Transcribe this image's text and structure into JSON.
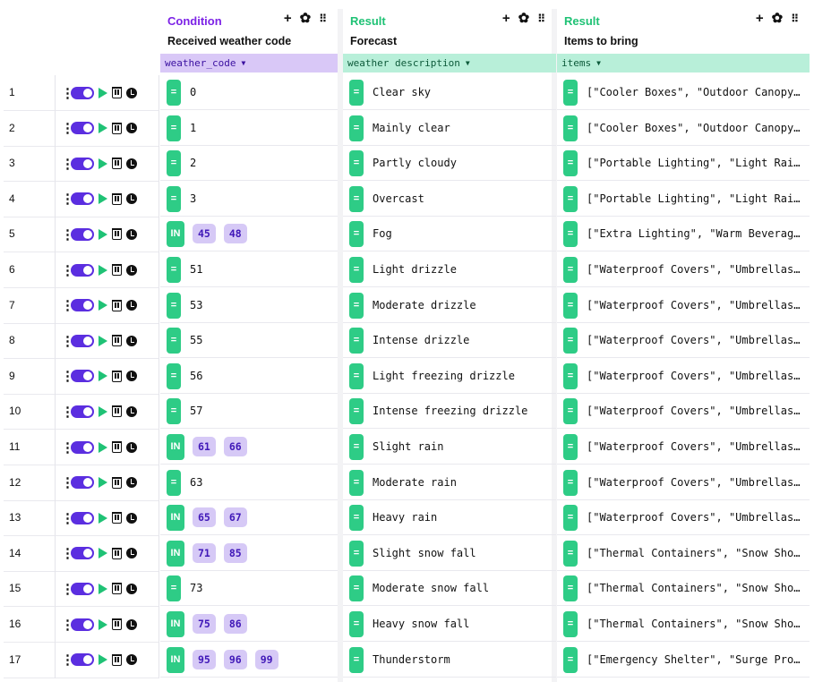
{
  "columns": {
    "condition": {
      "type": "Condition",
      "title": "Received weather code",
      "field": "weather_code"
    },
    "forecast": {
      "type": "Result",
      "title": "Forecast",
      "field": "weather description"
    },
    "items": {
      "type": "Result",
      "title": "Items to bring",
      "field": "items"
    }
  },
  "icons": {
    "add": "plus-icon",
    "settings": "gear-icon",
    "drag": "grip-icon",
    "row_menu": "kebab-icon",
    "toggle": "toggle-icon",
    "run": "play-icon",
    "delete": "trash-icon",
    "history": "clock-icon"
  },
  "colors": {
    "condition_accent": "#7c22e6",
    "result_accent": "#1fc275",
    "toggle": "#5b2ee0",
    "operator": "#2ecc86",
    "chip": "#d6c9f6"
  },
  "rows": [
    {
      "num": "1",
      "op": "=",
      "values": [
        "0"
      ],
      "forecast": "Clear sky",
      "items": "[\"Cooler Boxes\", \"Outdoor Canopy…"
    },
    {
      "num": "2",
      "op": "=",
      "values": [
        "1"
      ],
      "forecast": "Mainly clear",
      "items": "[\"Cooler Boxes\", \"Outdoor Canopy…"
    },
    {
      "num": "3",
      "op": "=",
      "values": [
        "2"
      ],
      "forecast": "Partly cloudy",
      "items": "[\"Portable Lighting\", \"Light Rai…"
    },
    {
      "num": "4",
      "op": "=",
      "values": [
        "3"
      ],
      "forecast": "Overcast",
      "items": "[\"Portable Lighting\", \"Light Rai…"
    },
    {
      "num": "5",
      "op": "IN",
      "values": [
        "45",
        "48"
      ],
      "forecast": "Fog",
      "items": "[\"Extra Lighting\", \"Warm Beverag…"
    },
    {
      "num": "6",
      "op": "=",
      "values": [
        "51"
      ],
      "forecast": "Light drizzle",
      "items": "[\"Waterproof Covers\", \"Umbrellas…"
    },
    {
      "num": "7",
      "op": "=",
      "values": [
        "53"
      ],
      "forecast": "Moderate drizzle",
      "items": "[\"Waterproof Covers\", \"Umbrellas…"
    },
    {
      "num": "8",
      "op": "=",
      "values": [
        "55"
      ],
      "forecast": "Intense drizzle",
      "items": "[\"Waterproof Covers\", \"Umbrellas…"
    },
    {
      "num": "9",
      "op": "=",
      "values": [
        "56"
      ],
      "forecast": "Light freezing drizzle",
      "items": "[\"Waterproof Covers\", \"Umbrellas…"
    },
    {
      "num": "10",
      "op": "=",
      "values": [
        "57"
      ],
      "forecast": "Intense freezing drizzle",
      "items": "[\"Waterproof Covers\", \"Umbrellas…"
    },
    {
      "num": "11",
      "op": "IN",
      "values": [
        "61",
        "66"
      ],
      "forecast": "Slight rain",
      "items": "[\"Waterproof Covers\", \"Umbrellas…"
    },
    {
      "num": "12",
      "op": "=",
      "values": [
        "63"
      ],
      "forecast": "Moderate rain",
      "items": "[\"Waterproof Covers\", \"Umbrellas…"
    },
    {
      "num": "13",
      "op": "IN",
      "values": [
        "65",
        "67"
      ],
      "forecast": "Heavy rain",
      "items": "[\"Waterproof Covers\", \"Umbrellas…"
    },
    {
      "num": "14",
      "op": "IN",
      "values": [
        "71",
        "85"
      ],
      "forecast": "Slight snow fall",
      "items": "[\"Thermal Containers\", \"Snow Sho…"
    },
    {
      "num": "15",
      "op": "=",
      "values": [
        "73"
      ],
      "forecast": "Moderate snow fall",
      "items": "[\"Thermal Containers\", \"Snow Sho…"
    },
    {
      "num": "16",
      "op": "IN",
      "values": [
        "75",
        "86"
      ],
      "forecast": "Heavy snow fall",
      "items": "[\"Thermal Containers\", \"Snow Sho…"
    },
    {
      "num": "17",
      "op": "IN",
      "values": [
        "95",
        "96",
        "99"
      ],
      "forecast": "Thunderstorm",
      "items": "[\"Emergency Shelter\", \"Surge Pro…"
    }
  ]
}
